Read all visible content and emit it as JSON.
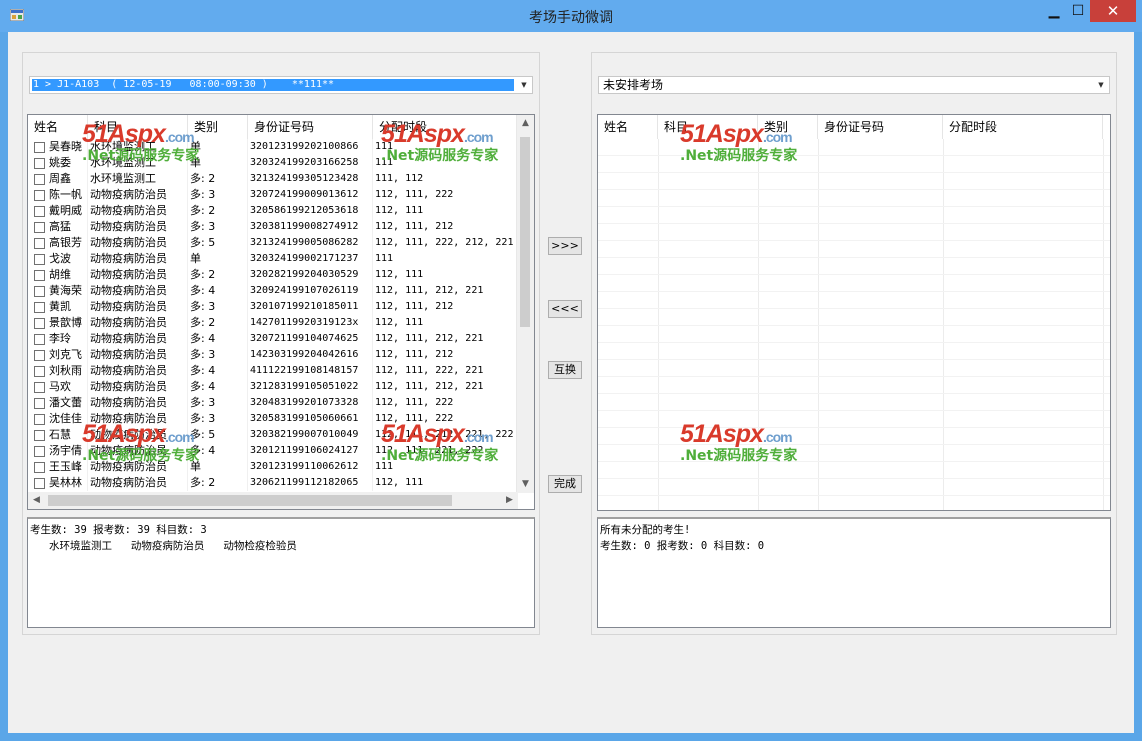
{
  "window": {
    "title": "考场手动微调"
  },
  "left": {
    "combo_value": "1 > J1-A103  ( 12-05-19   08:00-09:30 )    **111**",
    "columns": [
      "姓名",
      "科目",
      "类别",
      "身份证号码",
      "分配时段"
    ],
    "rows": [
      {
        "name": "吴春晓",
        "subject": "水环境监测工",
        "type": "单",
        "id": "320123199202100866",
        "period": "111"
      },
      {
        "name": "姚委",
        "subject": "水环境监测工",
        "type": "单",
        "id": "320324199203166258",
        "period": "111"
      },
      {
        "name": "周鑫",
        "subject": "水环境监测工",
        "type": "多: 2",
        "id": "321324199305123428",
        "period": "111, 112"
      },
      {
        "name": "陈一帆",
        "subject": "动物疫病防治员",
        "type": "多: 3",
        "id": "320724199009013612",
        "period": "112, 111, 222"
      },
      {
        "name": "戴明威",
        "subject": "动物疫病防治员",
        "type": "多: 2",
        "id": "320586199212053618",
        "period": "112, 111"
      },
      {
        "name": "高猛",
        "subject": "动物疫病防治员",
        "type": "多: 3",
        "id": "320381199008274912",
        "period": "112, 111, 212"
      },
      {
        "name": "高银芳",
        "subject": "动物疫病防治员",
        "type": "多: 5",
        "id": "321324199005086282",
        "period": "112, 111, 222, 212, 221"
      },
      {
        "name": "戈波",
        "subject": "动物疫病防治员",
        "type": "单",
        "id": "320324199002171237",
        "period": "111"
      },
      {
        "name": "胡维",
        "subject": "动物疫病防治员",
        "type": "多: 2",
        "id": "320282199204030529",
        "period": "112, 111"
      },
      {
        "name": "黄海荣",
        "subject": "动物疫病防治员",
        "type": "多: 4",
        "id": "320924199107026119",
        "period": "112, 111, 212, 221"
      },
      {
        "name": "黄凯",
        "subject": "动物疫病防治员",
        "type": "多: 3",
        "id": "320107199210185011",
        "period": "112, 111, 212"
      },
      {
        "name": "景歆博",
        "subject": "动物疫病防治员",
        "type": "多: 2",
        "id": "14270119920319123x",
        "period": "112, 111"
      },
      {
        "name": "李玲",
        "subject": "动物疫病防治员",
        "type": "多: 4",
        "id": "320721199104074625",
        "period": "112, 111, 212, 221"
      },
      {
        "name": "刘克飞",
        "subject": "动物疫病防治员",
        "type": "多: 3",
        "id": "142303199204042616",
        "period": "112, 111, 212"
      },
      {
        "name": "刘秋雨",
        "subject": "动物疫病防治员",
        "type": "多: 4",
        "id": "411122199108148157",
        "period": "112, 111, 222, 221"
      },
      {
        "name": "马欢",
        "subject": "动物疫病防治员",
        "type": "多: 4",
        "id": "321283199105051022",
        "period": "112, 111, 212, 221"
      },
      {
        "name": "潘文蕾",
        "subject": "动物疫病防治员",
        "type": "多: 3",
        "id": "320483199201073328",
        "period": "112, 111, 222"
      },
      {
        "name": "沈佳佳",
        "subject": "动物疫病防治员",
        "type": "多: 3",
        "id": "320583199105060661",
        "period": "112, 111, 222"
      },
      {
        "name": "石慧",
        "subject": "动物疫病防治员",
        "type": "多: 5",
        "id": "320382199007010049",
        "period": "112, 111, 212, 221, 222"
      },
      {
        "name": "汤宇倩",
        "subject": "动物疫病防治员",
        "type": "多: 4",
        "id": "320121199106024127",
        "period": "112, 111, 221, 222"
      },
      {
        "name": "王玉峰",
        "subject": "动物疫病防治员",
        "type": "单",
        "id": "320123199110062612",
        "period": "111"
      },
      {
        "name": "吴林林",
        "subject": "动物疫病防治员",
        "type": "多: 2",
        "id": "320621199112182065",
        "period": "112, 111"
      }
    ],
    "memo": [
      "考生数: 39 报考数: 39 科目数: 3",
      "   水环境监测工   动物疫病防治员   动物检疫检验员"
    ]
  },
  "right": {
    "combo_value": "未安排考场",
    "columns": [
      "姓名",
      "科目",
      "类别",
      "身份证号码",
      "分配时段"
    ],
    "memo": [
      "所有未分配的考生!",
      "考生数: 0 报考数: 0 科目数: 0"
    ]
  },
  "buttons": {
    "move_right": ">>>",
    "move_left": "<<<",
    "swap": "互换",
    "done": "完成"
  },
  "watermark": {
    "brand": "51Aspx",
    "domain": ".com",
    "tagline": ".Net源码服务专家"
  }
}
